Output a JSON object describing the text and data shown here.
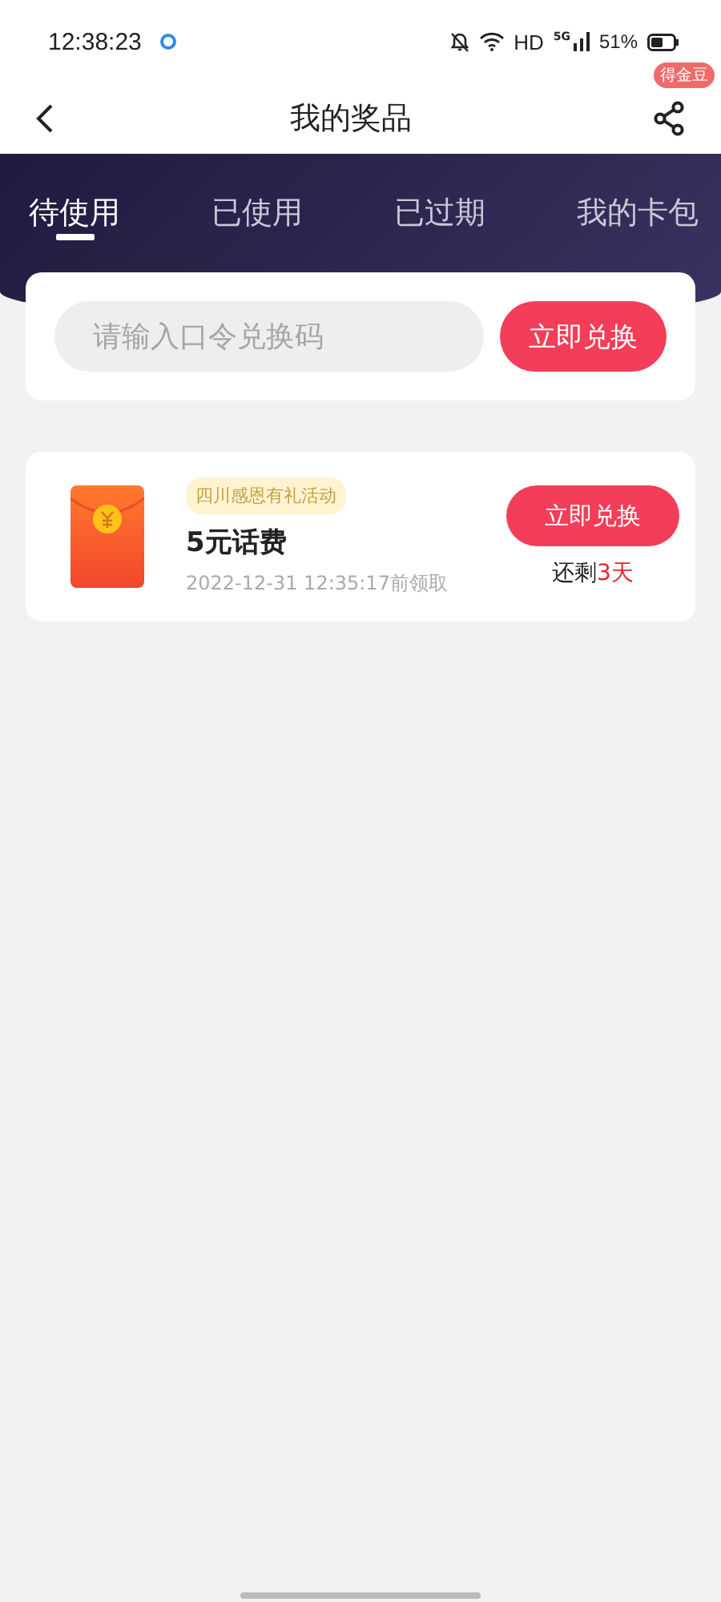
{
  "status_bar": {
    "time": "12:38:23",
    "network": "HD",
    "signal_label": "5G",
    "battery": "51%"
  },
  "header": {
    "title": "我的奖品",
    "badge": "得金豆"
  },
  "tabs": [
    {
      "label": "待使用",
      "selected": true
    },
    {
      "label": "已使用",
      "selected": false
    },
    {
      "label": "已过期",
      "selected": false
    },
    {
      "label": "我的卡包",
      "selected": false
    }
  ],
  "redeem": {
    "placeholder": "请输入口令兑换码",
    "button": "立即兑换"
  },
  "prizes": [
    {
      "tag": "四川感恩有礼活动",
      "title": "5元话费",
      "date": "2022-12-31 12:35:17前领取",
      "button": "立即兑换",
      "remaining_label": "还剩",
      "remaining_value": "3天"
    }
  ]
}
